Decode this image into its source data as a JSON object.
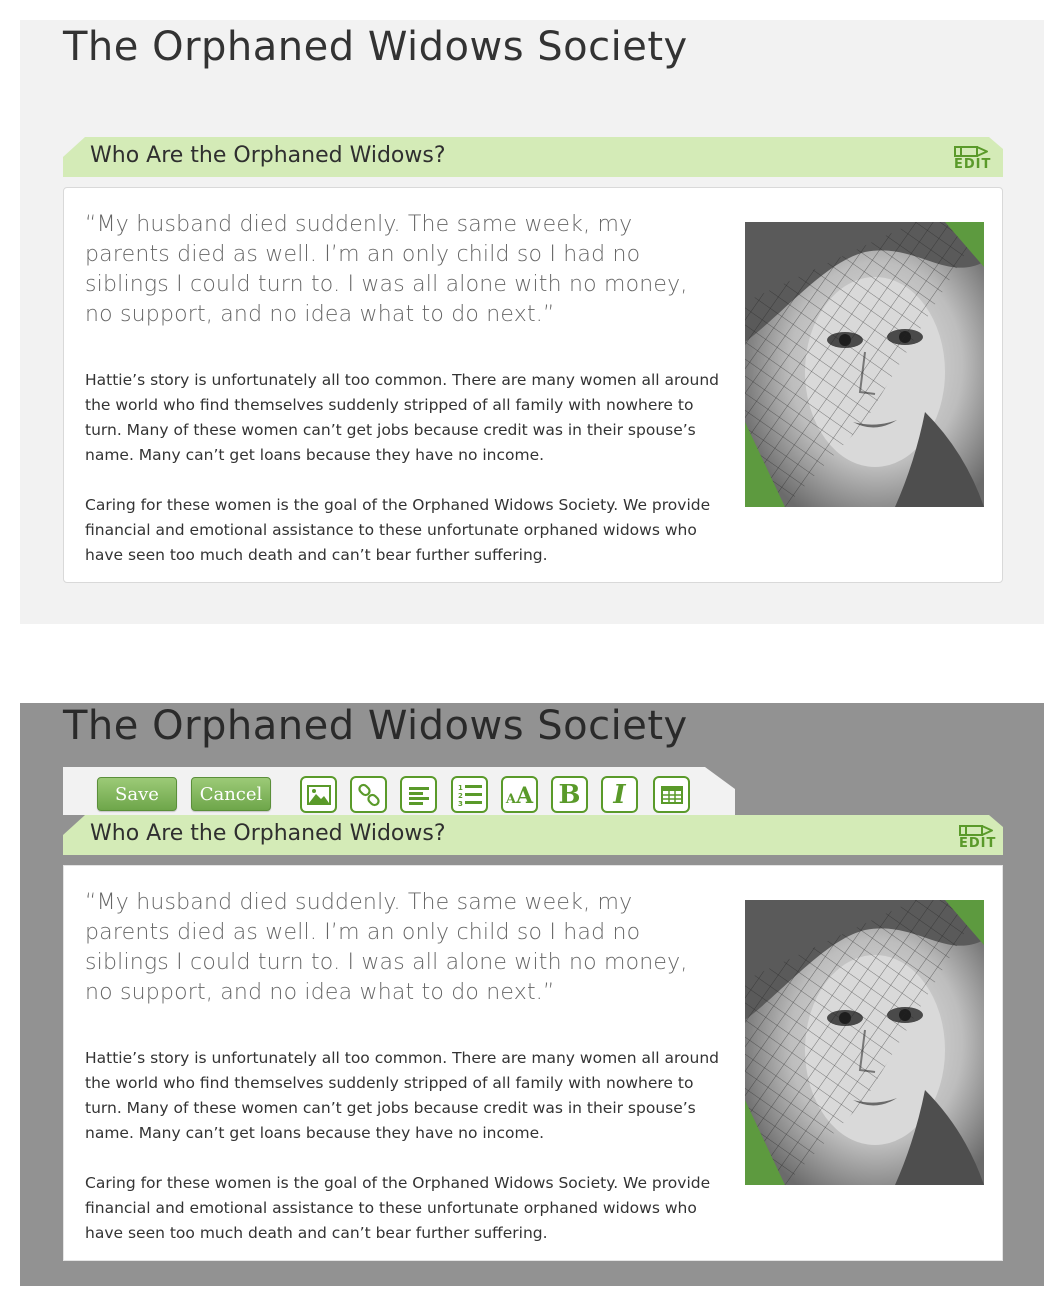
{
  "site": {
    "title": "The Orphaned Widows Society"
  },
  "section": {
    "title": "Who Are the Orphaned Widows?",
    "edit_label": "EDIT"
  },
  "content": {
    "quote": "“My husband died suddenly. The same week, my parents died as well. I’m an only child so I had no siblings I could turn to. I was all alone with no money, no support, and no idea what to do next.”",
    "paragraph1": "Hattie’s story is unfortunately all too common. There are many women all around the world who find themselves suddenly stripped of all family with nowhere to turn. Many of these women can’t get jobs because credit was in their spouse’s name. Many can’t get loans because they have no income.",
    "paragraph2": "Caring for these women is the goal of the Orphaned Widows Society. We provide financial and emotional assistance to these unfortunate orphaned widows who have seen too much death and can’t bear further suffering."
  },
  "toolbar": {
    "save_label": "Save",
    "cancel_label": "Cancel",
    "tools": [
      "image-icon",
      "link-icon",
      "align-left-icon",
      "numbered-list-icon",
      "font-size-icon",
      "bold-icon",
      "italic-icon",
      "table-icon"
    ],
    "font_size_glyph": "AA",
    "bold_glyph": "B",
    "italic_glyph": "I"
  },
  "colors": {
    "accent_green": "#5a9a2a",
    "header_green": "#d4ebb7",
    "view_bg": "#f2f2f2",
    "edit_overlay": "#929292"
  }
}
